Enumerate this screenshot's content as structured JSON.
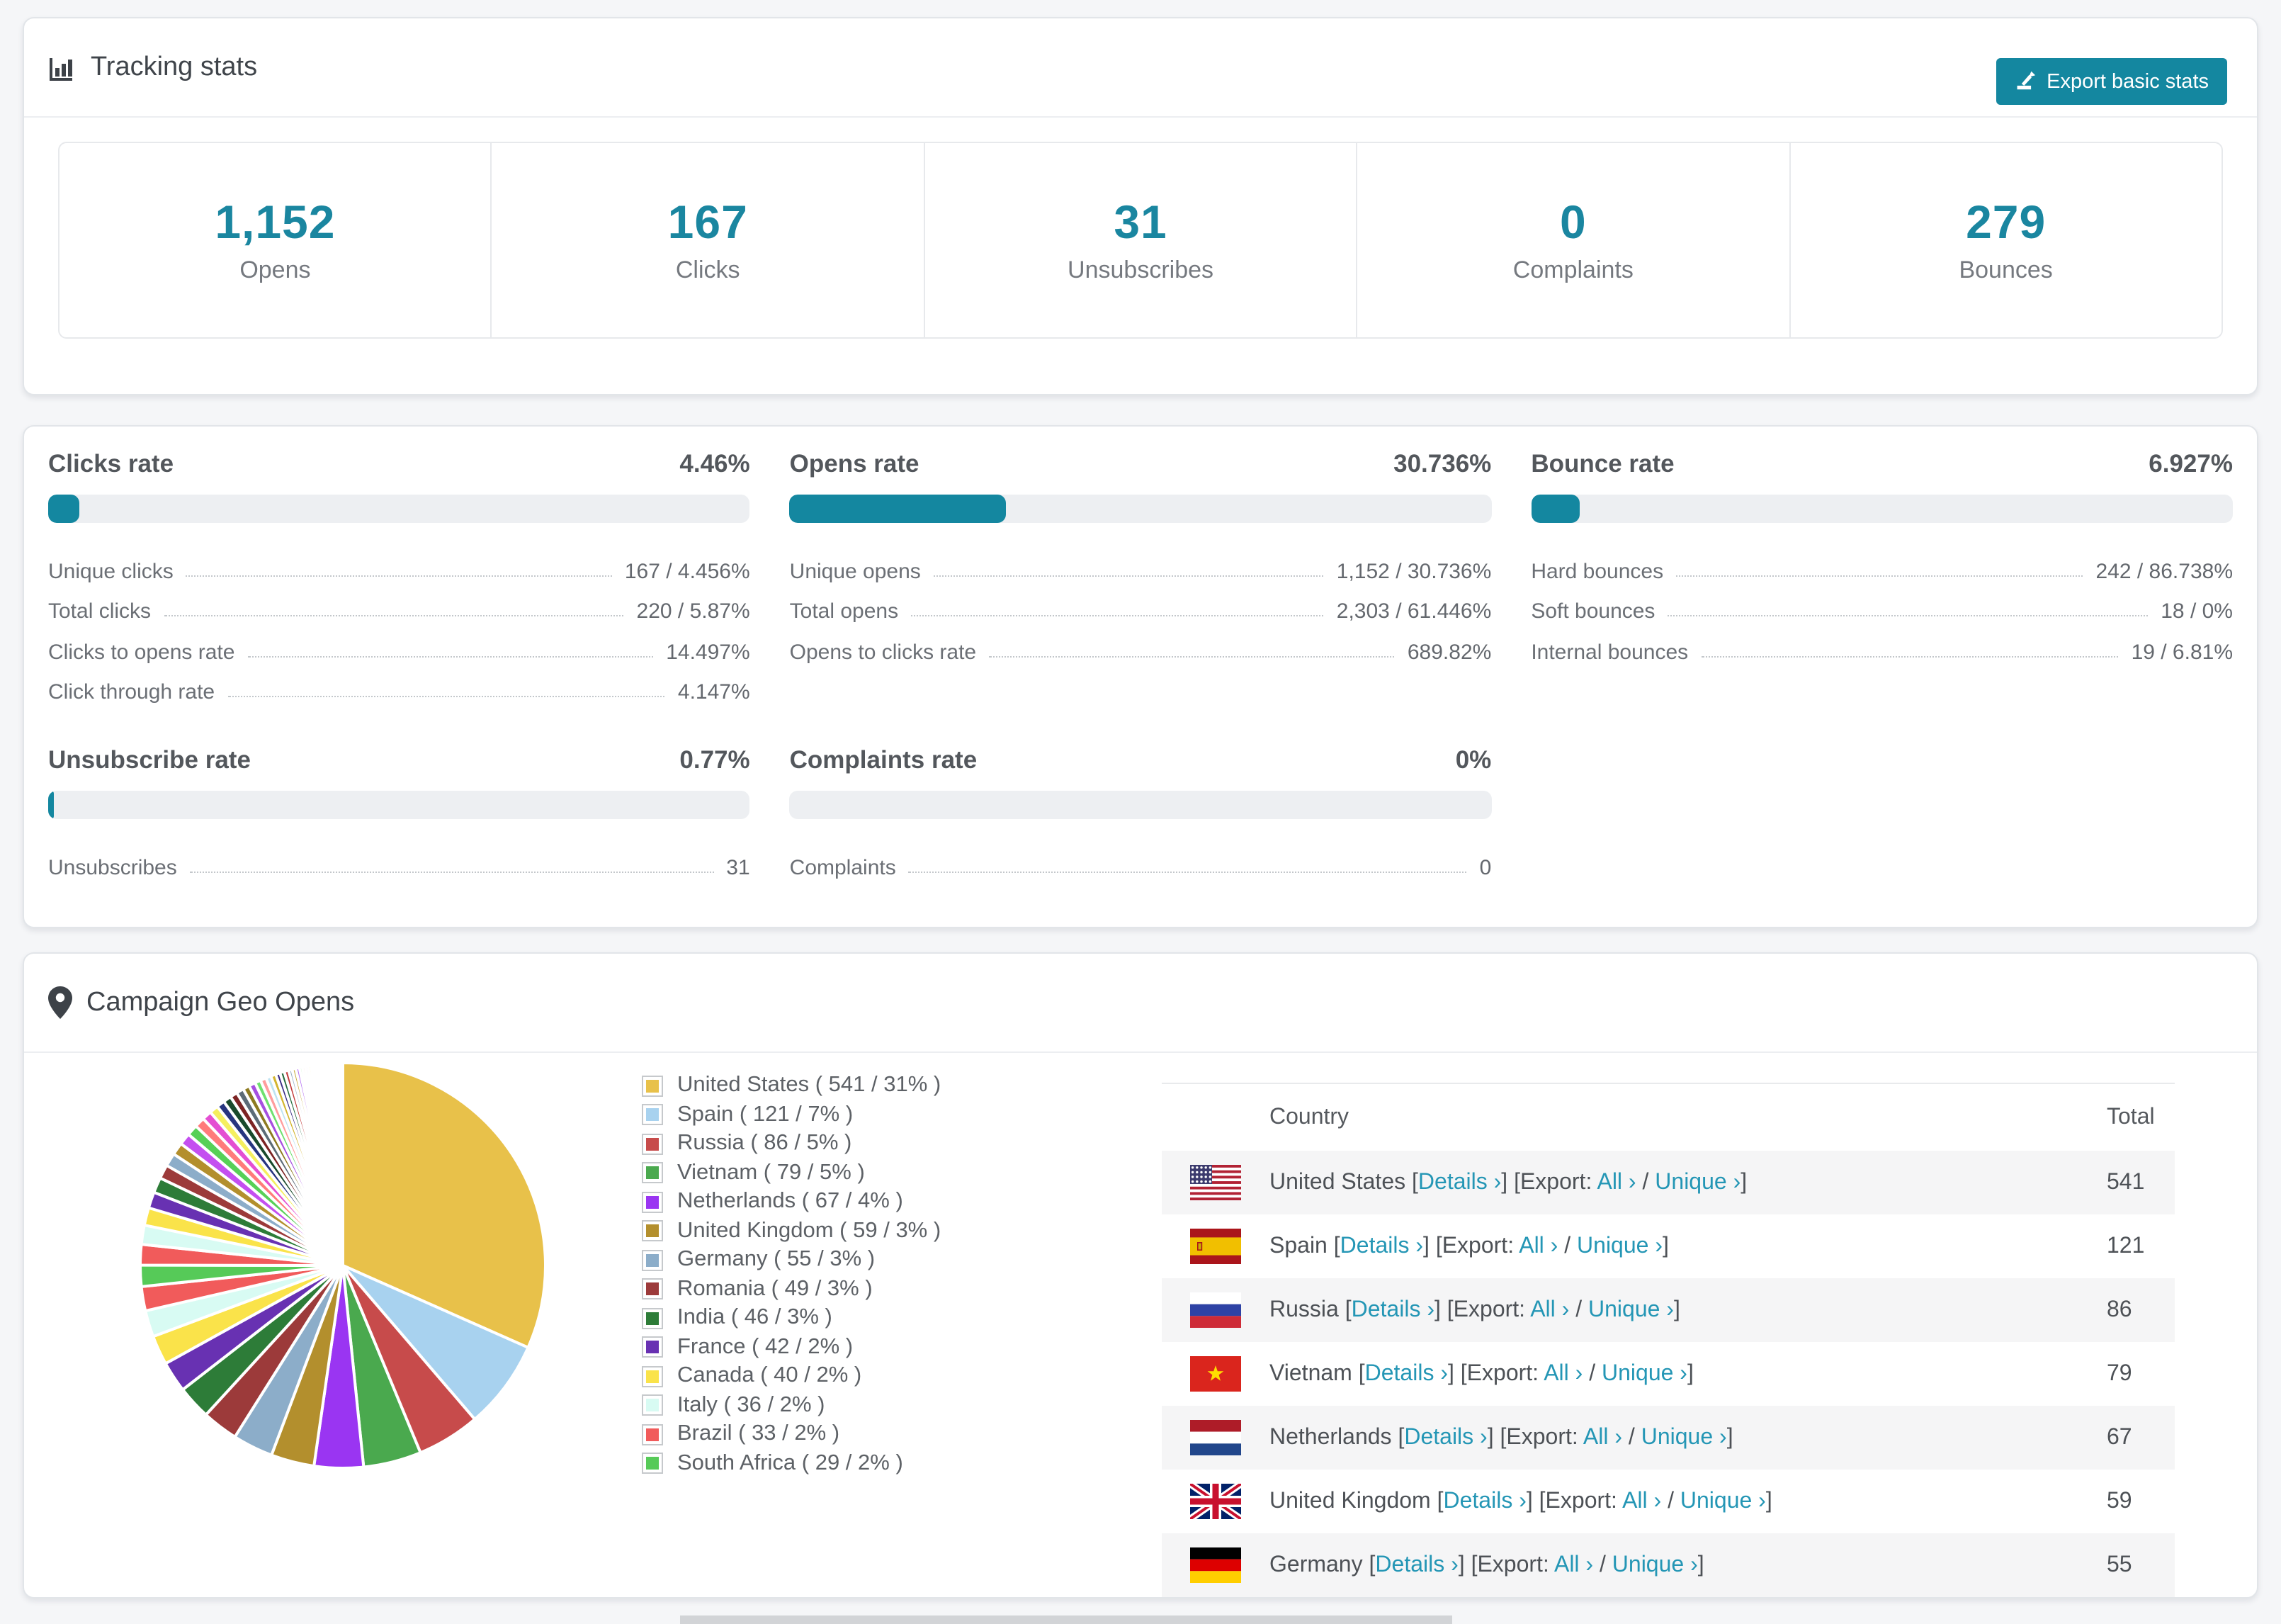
{
  "accent_color": "#1487a0",
  "link_color": "#2496b5",
  "tracking": {
    "icon": "bar-chart-icon",
    "title": "Tracking stats",
    "export_button": "Export basic stats",
    "stats": [
      {
        "value": "1,152",
        "label": "Opens"
      },
      {
        "value": "167",
        "label": "Clicks"
      },
      {
        "value": "31",
        "label": "Unsubscribes"
      },
      {
        "value": "0",
        "label": "Complaints"
      },
      {
        "value": "279",
        "label": "Bounces"
      }
    ]
  },
  "rates": {
    "blocks": [
      {
        "title": "Clicks rate",
        "value": "4.46%",
        "percent": 4.46,
        "rows": [
          [
            "Unique clicks",
            "167 / 4.456%"
          ],
          [
            "Total clicks",
            "220 / 5.87%"
          ],
          [
            "Clicks to opens rate",
            "14.497%"
          ],
          [
            "Click through rate",
            "4.147%"
          ]
        ]
      },
      {
        "title": "Opens rate",
        "value": "30.736%",
        "percent": 30.736,
        "rows": [
          [
            "Unique opens",
            "1,152 / 30.736%"
          ],
          [
            "Total opens",
            "2,303 / 61.446%"
          ],
          [
            "Opens to clicks rate",
            "689.82%"
          ]
        ]
      },
      {
        "title": "Bounce rate",
        "value": "6.927%",
        "percent": 6.927,
        "rows": [
          [
            "Hard bounces",
            "242 / 86.738%"
          ],
          [
            "Soft bounces",
            "18 / 0%"
          ],
          [
            "Internal bounces",
            "19 / 6.81%"
          ]
        ]
      },
      {
        "title": "Unsubscribe rate",
        "value": "0.77%",
        "percent": 0.77,
        "rows": [
          [
            "Unsubscribes",
            "31"
          ]
        ]
      },
      {
        "title": "Complaints rate",
        "value": "0%",
        "percent": 0,
        "rows": [
          [
            "Complaints",
            "0"
          ]
        ]
      }
    ]
  },
  "geo": {
    "icon": "location-pin-icon",
    "title": "Campaign Geo Opens",
    "table": {
      "columns": [
        "Country",
        "Total"
      ],
      "link_labels": {
        "details": "Details ›",
        "export_prefix": "[Export: ",
        "all": "All ›",
        "separator": " / ",
        "unique": "Unique ›",
        "open_bracket": "[",
        "close_bracket": "]"
      },
      "rows": [
        {
          "flag": "us",
          "country": "United States",
          "total": "541"
        },
        {
          "flag": "es",
          "country": "Spain",
          "total": "121"
        },
        {
          "flag": "ru",
          "country": "Russia",
          "total": "86"
        },
        {
          "flag": "vn",
          "country": "Vietnam",
          "total": "79"
        },
        {
          "flag": "nl",
          "country": "Netherlands",
          "total": "67"
        },
        {
          "flag": "gb",
          "country": "United Kingdom",
          "total": "59"
        },
        {
          "flag": "de",
          "country": "Germany",
          "total": "55"
        }
      ]
    }
  },
  "chart_data": {
    "type": "pie",
    "title": "Campaign Geo Opens",
    "legend_position": "right",
    "start_angle_deg": -90,
    "direction": "clockwise",
    "categories": [
      "United States",
      "Spain",
      "Russia",
      "Vietnam",
      "Netherlands",
      "United Kingdom",
      "Germany",
      "Romania",
      "India",
      "France",
      "Canada",
      "Italy",
      "Brazil",
      "South Africa"
    ],
    "values": [
      541,
      121,
      86,
      79,
      67,
      59,
      55,
      49,
      46,
      42,
      40,
      36,
      33,
      29
    ],
    "percents": [
      31,
      7,
      5,
      5,
      4,
      3,
      3,
      3,
      3,
      2,
      2,
      2,
      2,
      2
    ],
    "colors": [
      "#e8c14a",
      "#a8d2ef",
      "#c74b4b",
      "#4aa94e",
      "#9a35f2",
      "#b38f2d",
      "#8cadc9",
      "#9c3a3a",
      "#2d7c38",
      "#6831b2",
      "#fae34a",
      "#d8fbf3",
      "#f15b5b",
      "#56ca58"
    ],
    "legend_format": "{name} ( {value} / {percent}% )",
    "others": {
      "note": "many small unlabeled slices fading clockwise",
      "values": [
        28,
        26,
        24,
        22,
        21,
        19,
        18,
        17,
        16,
        15,
        14,
        13,
        12,
        11,
        11,
        10,
        10,
        9,
        9,
        8,
        8,
        7,
        7,
        6,
        6,
        6,
        5,
        5,
        5,
        4,
        4,
        4,
        4,
        3,
        3,
        3,
        3,
        3,
        2,
        2,
        2,
        2,
        2,
        2,
        2,
        2,
        1,
        1,
        1,
        1,
        1,
        1,
        1,
        1,
        1,
        1,
        1,
        1
      ],
      "palette": [
        "#f15b5b",
        "#d8fbf3",
        "#fae34a",
        "#6831b2",
        "#2d7c38",
        "#9c3a3a",
        "#8cadc9",
        "#b38f2d",
        "#c44ff0",
        "#57d057",
        "#ff7b7b",
        "#e44fd2",
        "#f5ef5e",
        "#27357f",
        "#194a2c",
        "#7c2424",
        "#5c6b77",
        "#8d7a20",
        "#a64fe0",
        "#6fe06f",
        "#ff9d9d",
        "#bfe3f2",
        "#d3b52f",
        "#3b2d85",
        "#246b3c",
        "#c23b3b",
        "#9db4c8",
        "#c9a93a",
        "#b36ef2",
        "#86e886",
        "#ffc2c2",
        "#e8c9f2",
        "#fbf289",
        "#4d5cae",
        "#2f7f55",
        "#d45656",
        "#b2c4d4",
        "#dcc45c",
        "#d19bff",
        "#a9f0a9"
      ]
    }
  }
}
